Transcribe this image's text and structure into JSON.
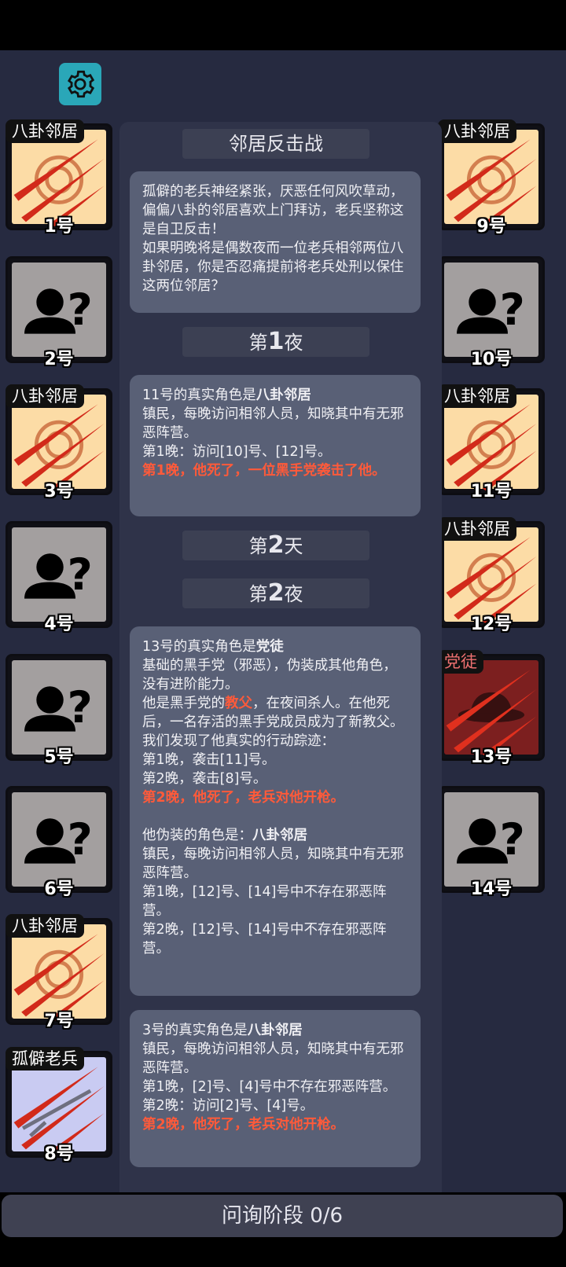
{
  "log_title": "邻居反击战",
  "intro_text": "孤僻的老兵神经紧张，厌恶任何风吹草动，偏偏八卦的邻居喜欢上门拜访，老兵坚称这是自卫反击！\n如果明晚将是偶数夜而一位老兵相邻两位八卦邻居，你是否忍痛提前将老兵处刑以保住这两位邻居？",
  "headers": {
    "night1_pre": "第",
    "night1_num": "1",
    "night1_post": "夜",
    "day2_pre": "第",
    "day2_num": "2",
    "day2_post": "天",
    "night2_pre": "第",
    "night2_num": "2",
    "night2_post": "夜"
  },
  "cards": {
    "p11": {
      "role_line_a": "11号的真实角色是",
      "role_line_b": "八卦邻居",
      "desc": "镇民，每晚访问相邻人员，知晓其中有无邪恶阵营。",
      "night1": "第1晚：访问[10]号、[12]号。",
      "death": "第1晚，他死了，一位黑手党袭击了他。"
    },
    "p13": {
      "role_line_a": "13号的真实角色是",
      "role_line_b": "党徒",
      "desc": "基础的黑手党（邪恶），伪装成其他角色，没有进阶能力。",
      "gf_a": "他是黑手党的",
      "gf_b": "教父",
      "gf_c": "，在夜间杀人。在他死后，一名存活的黑手党成员成为了新教父。",
      "found": "我们发现了他真实的行动踪迹：",
      "n1": "第1晚，袭击[11]号。",
      "n2": "第2晚，袭击[8]号。",
      "death": "第2晚，他死了，老兵对他开枪。",
      "fake_a": "他伪装的角色是：",
      "fake_b": "八卦邻居",
      "fake_desc": "镇民，每晚访问相邻人员，知晓其中有无邪恶阵营。",
      "fake_n1": "第1晚，[12]号、[14]号中不存在邪恶阵营。",
      "fake_n2": "第2晚，[12]号、[14]号中不存在邪恶阵营。"
    },
    "p3": {
      "role_line_a": "3号的真实角色是",
      "role_line_b": "八卦邻居",
      "desc": "镇民，每晚访问相邻人员，知晓其中有无邪恶阵营。",
      "n1": "第1晚，[2]号、[4]号中不存在邪恶阵营。",
      "n2": "第2晚：访问[2]号、[4]号。",
      "death": "第2晚，他死了，老兵对他开枪。"
    }
  },
  "players": {
    "p1": {
      "num": "1号",
      "role": "八卦邻居",
      "state": "dead",
      "kind": "neighbor"
    },
    "p2": {
      "num": "2号",
      "role": "",
      "state": "alive",
      "kind": "unknown"
    },
    "p3": {
      "num": "3号",
      "role": "八卦邻居",
      "state": "dead",
      "kind": "neighbor"
    },
    "p4": {
      "num": "4号",
      "role": "",
      "state": "alive",
      "kind": "unknown"
    },
    "p5": {
      "num": "5号",
      "role": "",
      "state": "alive",
      "kind": "unknown"
    },
    "p6": {
      "num": "6号",
      "role": "",
      "state": "alive",
      "kind": "unknown"
    },
    "p7": {
      "num": "7号",
      "role": "八卦邻居",
      "state": "dead",
      "kind": "neighbor"
    },
    "p8": {
      "num": "8号",
      "role": "孤僻老兵",
      "state": "dead",
      "kind": "veteran"
    },
    "p9": {
      "num": "9号",
      "role": "八卦邻居",
      "state": "dead",
      "kind": "neighbor"
    },
    "p10": {
      "num": "10号",
      "role": "",
      "state": "alive",
      "kind": "unknown"
    },
    "p11": {
      "num": "11号",
      "role": "八卦邻居",
      "state": "dead",
      "kind": "neighbor"
    },
    "p12": {
      "num": "12号",
      "role": "八卦邻居",
      "state": "dead",
      "kind": "neighbor"
    },
    "p13": {
      "num": "13号",
      "role": "党徒",
      "state": "dead",
      "kind": "mafia"
    },
    "p14": {
      "num": "14号",
      "role": "",
      "state": "alive",
      "kind": "unknown"
    }
  },
  "phase": "问询阶段 0/6",
  "colors": {
    "background": "#262a40",
    "card": "#596076",
    "header": "#3c4053",
    "accent": "#2aa7b8",
    "death_text": "#ff5a3a"
  }
}
